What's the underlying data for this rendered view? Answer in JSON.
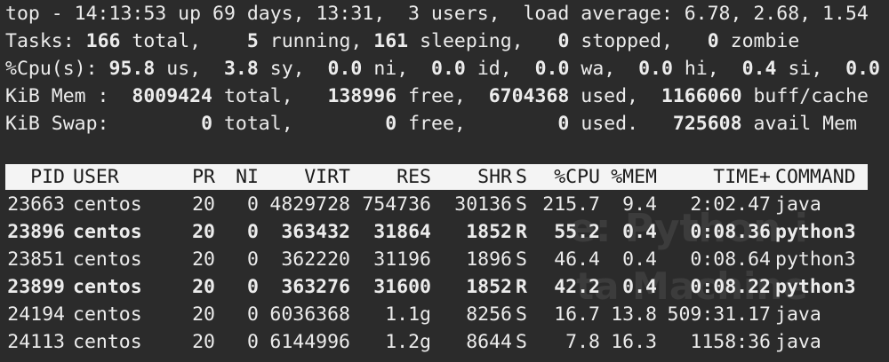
{
  "summary": {
    "line1": "top - 14:13:53 up 69 days, 13:31,  3 users,  load average: 6.78, 2.68, 1.54",
    "tasks": {
      "label": "Tasks:",
      "total": "166",
      "total_label": "total,",
      "running": "5",
      "running_label": "running,",
      "sleeping": "161",
      "sleeping_label": "sleeping,",
      "stopped": "0",
      "stopped_label": "stopped,",
      "zombie": "0",
      "zombie_label": "zombie"
    },
    "cpu": {
      "label": "%Cpu(s):",
      "us": "95.8",
      "us_label": "us,",
      "sy": "3.8",
      "sy_label": "sy,",
      "ni": "0.0",
      "ni_label": "ni,",
      "id": "0.0",
      "id_label": "id,",
      "wa": "0.0",
      "wa_label": "wa,",
      "hi": "0.0",
      "hi_label": "hi,",
      "si": "0.4",
      "si_label": "si,",
      "st": "0.0"
    },
    "mem": {
      "label": "KiB Mem :",
      "total": "8009424",
      "total_label": "total,",
      "free": "138996",
      "free_label": "free,",
      "used": "6704368",
      "used_label": "used,",
      "buff": "1166060",
      "buff_label": "buff/cache"
    },
    "swap": {
      "label": "KiB Swap:",
      "total": "0",
      "total_label": "total,",
      "free": "0",
      "free_label": "free,",
      "used": "0",
      "used_label": "used.",
      "avail": "725608",
      "avail_label": "avail Mem"
    }
  },
  "process_table": {
    "columns": [
      "PID",
      "USER",
      "PR",
      "NI",
      "VIRT",
      "RES",
      "SHR",
      "S",
      "%CPU",
      "%MEM",
      "TIME+",
      "COMMAND"
    ],
    "rows": [
      {
        "pid": "23663",
        "user": "centos",
        "pr": "20",
        "ni": "0",
        "virt": "4829728",
        "res": "754736",
        "shr": "30136",
        "s": "S",
        "cpu": "215.7",
        "mem": "9.4",
        "time": "2:02.47",
        "cmd": "java",
        "bold": false
      },
      {
        "pid": "23896",
        "user": "centos",
        "pr": "20",
        "ni": "0",
        "virt": "363432",
        "res": "31864",
        "shr": "1852",
        "s": "R",
        "cpu": "55.2",
        "mem": "0.4",
        "time": "0:08.36",
        "cmd": "python3",
        "bold": true
      },
      {
        "pid": "23851",
        "user": "centos",
        "pr": "20",
        "ni": "0",
        "virt": "362220",
        "res": "31196",
        "shr": "1896",
        "s": "S",
        "cpu": "46.4",
        "mem": "0.4",
        "time": "0:08.64",
        "cmd": "python3",
        "bold": false
      },
      {
        "pid": "23899",
        "user": "centos",
        "pr": "20",
        "ni": "0",
        "virt": "363276",
        "res": "31600",
        "shr": "1852",
        "s": "R",
        "cpu": "42.2",
        "mem": "0.4",
        "time": "0:08.22",
        "cmd": "python3",
        "bold": true
      },
      {
        "pid": "24194",
        "user": "centos",
        "pr": "20",
        "ni": "0",
        "virt": "6036368",
        "res": "1.1g",
        "shr": "8256",
        "s": "S",
        "cpu": "16.7",
        "mem": "13.8",
        "time": "509:31.17",
        "cmd": "java",
        "bold": false
      },
      {
        "pid": "24113",
        "user": "centos",
        "pr": "20",
        "ni": "0",
        "virt": "6144996",
        "res": "1.2g",
        "shr": "8644",
        "s": "S",
        "cpu": "7.8",
        "mem": "16.3",
        "time": "1158:36",
        "cmd": "java",
        "bold": false
      }
    ]
  },
  "colors": {
    "background": "#2b2b2b",
    "text": "#ececec",
    "header_bg": "#f4f4f4",
    "header_text": "#1a1a1a"
  }
}
